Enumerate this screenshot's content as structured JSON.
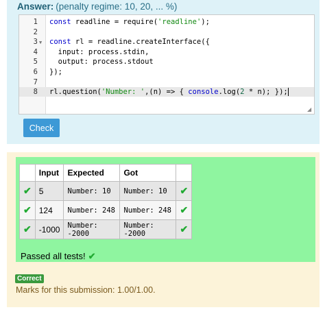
{
  "answer": {
    "label": "Answer:",
    "regime": "(penalty regime: 10, 20, ... %)"
  },
  "editor": {
    "lines": [
      {
        "num": "1",
        "fold": "",
        "text": "const readline = require('readline');"
      },
      {
        "num": "2",
        "fold": "",
        "text": ""
      },
      {
        "num": "3",
        "fold": "▼",
        "text": "const rl = readline.createInterface({"
      },
      {
        "num": "4",
        "fold": "",
        "text": "  input: process.stdin,"
      },
      {
        "num": "5",
        "fold": "",
        "text": "  output: process.stdout"
      },
      {
        "num": "6",
        "fold": "",
        "text": "});"
      },
      {
        "num": "7",
        "fold": "",
        "text": ""
      },
      {
        "num": "8",
        "fold": "",
        "text": "rl.question('Number: ',(n) => { console.log(2 * n); });"
      }
    ],
    "active_line": 8
  },
  "check_button": {
    "label": "Check"
  },
  "results": {
    "headers": [
      "",
      "Input",
      "Expected",
      "Got",
      ""
    ],
    "rows": [
      {
        "status": "✔",
        "input": "5",
        "expected": "Number: 10",
        "got": "Number: 10",
        "result": "✔"
      },
      {
        "status": "✔",
        "input": "124",
        "expected": "Number: 248",
        "got": "Number: 248",
        "result": "✔"
      },
      {
        "status": "✔",
        "input": "-1000",
        "expected": "Number: -2000",
        "got": "Number: -2000",
        "result": "✔"
      }
    ],
    "summary": "Passed all tests!",
    "summary_icon": "✔"
  },
  "grade": {
    "badge": "Correct",
    "marks": "Marks for this submission: 1.00/1.00."
  },
  "colors": {
    "answer_bg": "#def2f8",
    "result_bg": "#fcf3d9",
    "pass_bg": "#8ff5a0",
    "check_button": "#3d99d6",
    "badge": "#3a9a3e"
  }
}
